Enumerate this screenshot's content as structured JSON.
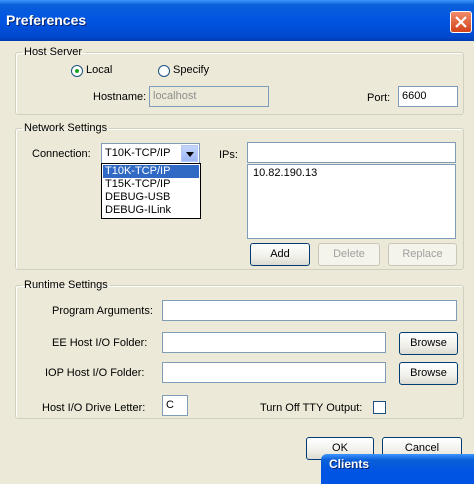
{
  "window": {
    "title": "Preferences"
  },
  "host_server": {
    "legend": "Host Server",
    "local_label": "Local",
    "specify_label": "Specify",
    "selected": "Local",
    "hostname_label": "Hostname:",
    "hostname_value": "localhost",
    "port_label": "Port:",
    "port_value": "6600"
  },
  "network": {
    "legend": "Network Settings",
    "connection_label": "Connection:",
    "connection_value": "T10K-TCP/IP",
    "options": [
      "T10K-TCP/IP",
      "T15K-TCP/IP",
      "DEBUG-USB",
      "DEBUG-ILink"
    ],
    "ips_label": "IPs:",
    "ip_input_value": "",
    "ip_list": [
      "10.82.190.13"
    ],
    "add_label": "Add",
    "delete_label": "Delete",
    "replace_label": "Replace"
  },
  "runtime": {
    "legend": "Runtime Settings",
    "program_args_label": "Program Arguments:",
    "program_args_value": "",
    "ee_folder_label": "EE Host I/O Folder:",
    "ee_folder_value": "",
    "iop_folder_label": "IOP Host I/O Folder:",
    "iop_folder_value": "",
    "browse_label": "Browse",
    "drive_letter_label": "Host I/O Drive Letter:",
    "drive_letter_value": "C",
    "tty_label": "Turn Off TTY Output:",
    "tty_checked": false
  },
  "footer": {
    "ok_label": "OK",
    "cancel_label": "Cancel"
  },
  "background_window": {
    "title": "Clients"
  },
  "colors": {
    "titlebar": "#0054e3",
    "selection": "#316ac5",
    "dialog_bg": "#ece9d8"
  }
}
